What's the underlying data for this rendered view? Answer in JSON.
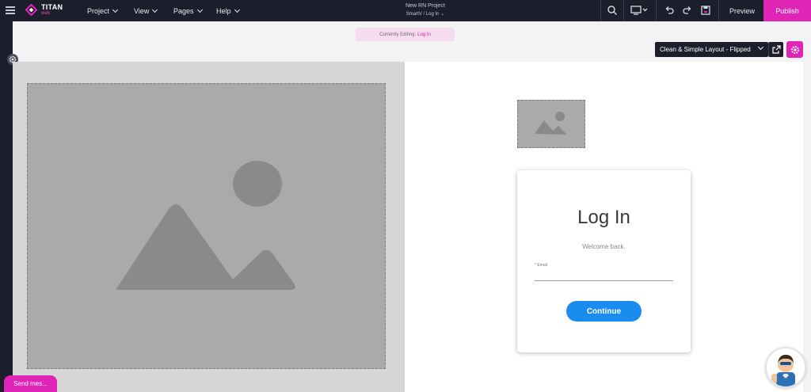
{
  "app": {
    "logo_name": "TITAN",
    "logo_sub": "web"
  },
  "topbar": {
    "menus": [
      "Project",
      "View",
      "Pages",
      "Help"
    ],
    "project_title": "New RN Project",
    "project_path": "SmartV / Log In",
    "preview_label": "Preview",
    "publish_label": "Publish",
    "icons": [
      "search-icon",
      "monitor-icon",
      "undo-icon",
      "redo-icon",
      "save-icon"
    ]
  },
  "editor": {
    "editing_prefix": "Currently Editing:",
    "editing_page": "Log In",
    "layout_name": "Clean & Simple Layout - Flipped"
  },
  "login_card": {
    "title": "Log In",
    "subtitle": "Welcome back.",
    "email_label": "* Email",
    "email_value": "",
    "continue_label": "Continue"
  },
  "chat": {
    "send_label": "Send mes..."
  },
  "colors": {
    "accent": "#e024b5",
    "topbar": "#1c1f2b",
    "button_blue": "#1a8cf0"
  }
}
